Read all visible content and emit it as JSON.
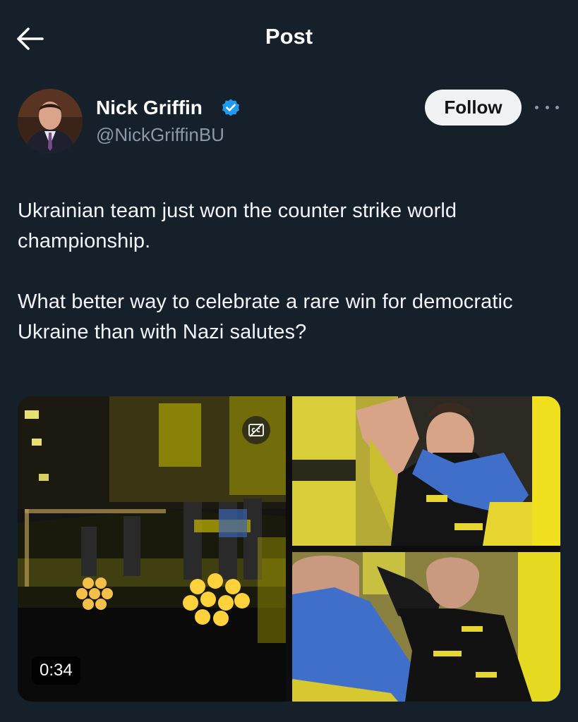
{
  "header": {
    "back_icon": "arrow-left-icon",
    "title": "Post"
  },
  "author": {
    "name": "Nick Griffin",
    "handle": "@NickGriffinBU",
    "verified_icon": "verified-badge-icon",
    "verified_color": "#1d9bf0",
    "follow_label": "Follow",
    "more_icon": "more-horizontal-icon"
  },
  "post": {
    "paragraphs": [
      "Ukrainian team just won the counter strike world championship.",
      "What better way to celebrate a rare win for democratic Ukraine than with Nazi salutes?"
    ]
  },
  "media": {
    "items": [
      {
        "kind": "video",
        "cc_icon": "closed-captions-icon",
        "duration": "0:34"
      },
      {
        "kind": "image"
      },
      {
        "kind": "image"
      }
    ]
  },
  "colors": {
    "background": "#15202b",
    "text_primary": "#ffffff",
    "text_secondary": "#8b98a5",
    "follow_button_bg": "#eff3f4",
    "brand_yellow": "#f2e600",
    "flag_blue": "#3f6fc8"
  }
}
